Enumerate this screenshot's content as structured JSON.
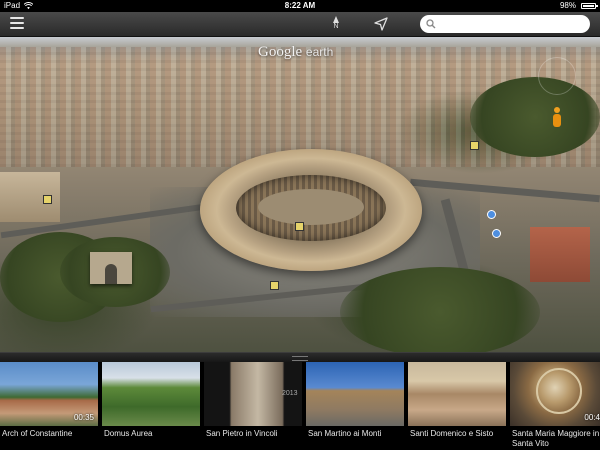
{
  "status": {
    "carrier": "iPad",
    "time": "8:22 AM",
    "battery_pct": "98%",
    "battery_level": 0.98
  },
  "toolbar": {
    "compass_letter": "N",
    "search_placeholder": ""
  },
  "map": {
    "logo_google": "Google",
    "logo_earth": "earth"
  },
  "tours": [
    {
      "label": "Arch of Constantine",
      "duration": "00:35"
    },
    {
      "label": "Domus Aurea",
      "duration": ""
    },
    {
      "label": "San Pietro in Vincoli",
      "duration": ""
    },
    {
      "label": "San Martino ai Monti",
      "duration": ""
    },
    {
      "label": "Santi Domenico e Sisto",
      "duration": ""
    },
    {
      "label": "Santa Maria Maggiore in Santa Vito",
      "duration": "00:4"
    }
  ],
  "copyright": "2013"
}
